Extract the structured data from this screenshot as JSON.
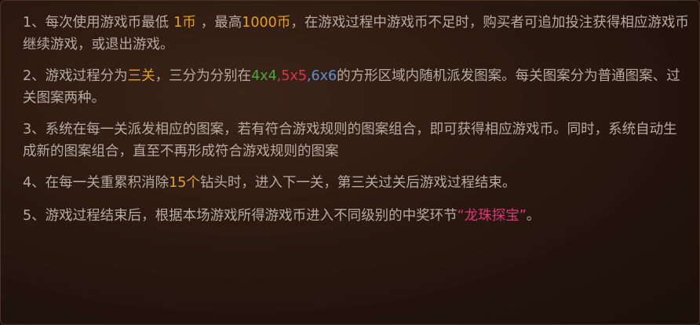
{
  "rules": [
    {
      "p1": "1、每次使用游戏币最低",
      "min": "1币",
      "p2": "，最高",
      "max": "1000币",
      "p3": "，在游戏过程中游戏币不足时，购买者可追加投注获得相应游戏币继续游戏，或退出游戏。"
    },
    {
      "p1": "2、游戏过程分为",
      "levels": "三关",
      "p2": "，三分为分别在",
      "g1": "4x4",
      "c1": ",",
      "g2": "5x5",
      "c2": ",",
      "g3": "6x6",
      "p3": "的方形区域内随机派发图案。每关图案分为普通图案、过关图案两种。"
    },
    {
      "text": "3、系统在每一关派发相应的图案，若有符合游戏规则的图案组合，即可获得相应游戏币。同时，系统自动生成新的图案组合，直至不再形成符合游戏规则的图案"
    },
    {
      "p1": "4、在每一关重累积消除",
      "count": "15个",
      "p2": "钻头时，进入下一关，第三关过关后游戏过程结束。"
    },
    {
      "p1": "5、游戏过程结束后，根据本场游戏所得游戏币进入不同级别的中奖环节",
      "bonus": "“龙珠探宝”",
      "p2": "。"
    }
  ],
  "colors": {
    "text": "#b7aaa0",
    "orange": "#e6a11c",
    "green": "#4aa83b",
    "red": "#d8344d",
    "blue": "#5b8fd4",
    "pink": "#e0357a",
    "background": "#2c1a11"
  }
}
